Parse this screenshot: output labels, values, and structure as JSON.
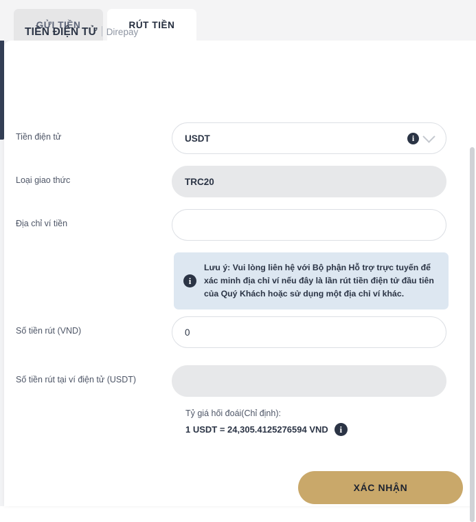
{
  "tabs": [
    {
      "label": "GỬI TIỀN",
      "active": false
    },
    {
      "label": "RÚT TIỀN",
      "active": true
    }
  ],
  "header": {
    "title": "TIỀN ĐIỆN TỬ",
    "provider": "Direpay"
  },
  "form": {
    "currency": {
      "label": "Tiền điện tử",
      "value": "USDT"
    },
    "protocol": {
      "label": "Loại giao thức",
      "value": "TRC20"
    },
    "wallet_address": {
      "label": "Địa chỉ ví tiền",
      "value": "",
      "placeholder": ""
    },
    "amount_vnd": {
      "label": "Số tiền rút (VND)",
      "value": "0",
      "placeholder": ""
    },
    "amount_crypto": {
      "label": "Số tiền rút tại ví điện tử (USDT)",
      "value": "",
      "placeholder": ""
    }
  },
  "notice": {
    "text": "Lưu ý: Vui lòng liên hệ với Bộ phận Hỗ trợ trực tuyến để xác minh địa chỉ ví nếu đây là lần rút tiền điện tử đầu tiên của Quý Khách hoặc sử dụng một địa chỉ ví khác."
  },
  "exchange_rate": {
    "label": "Tỷ giá hối đoái(Chỉ định):",
    "value": "1 USDT = 24,305.4125276594 VND"
  },
  "confirm_button": {
    "label": "XÁC NHẬN"
  },
  "icons": {
    "info": "i"
  },
  "colors": {
    "accent_gold": "#c9a86a",
    "dark_navy": "#2b3445",
    "notice_bg": "#dde7f1",
    "disabled_bg": "#e7e8ea"
  }
}
